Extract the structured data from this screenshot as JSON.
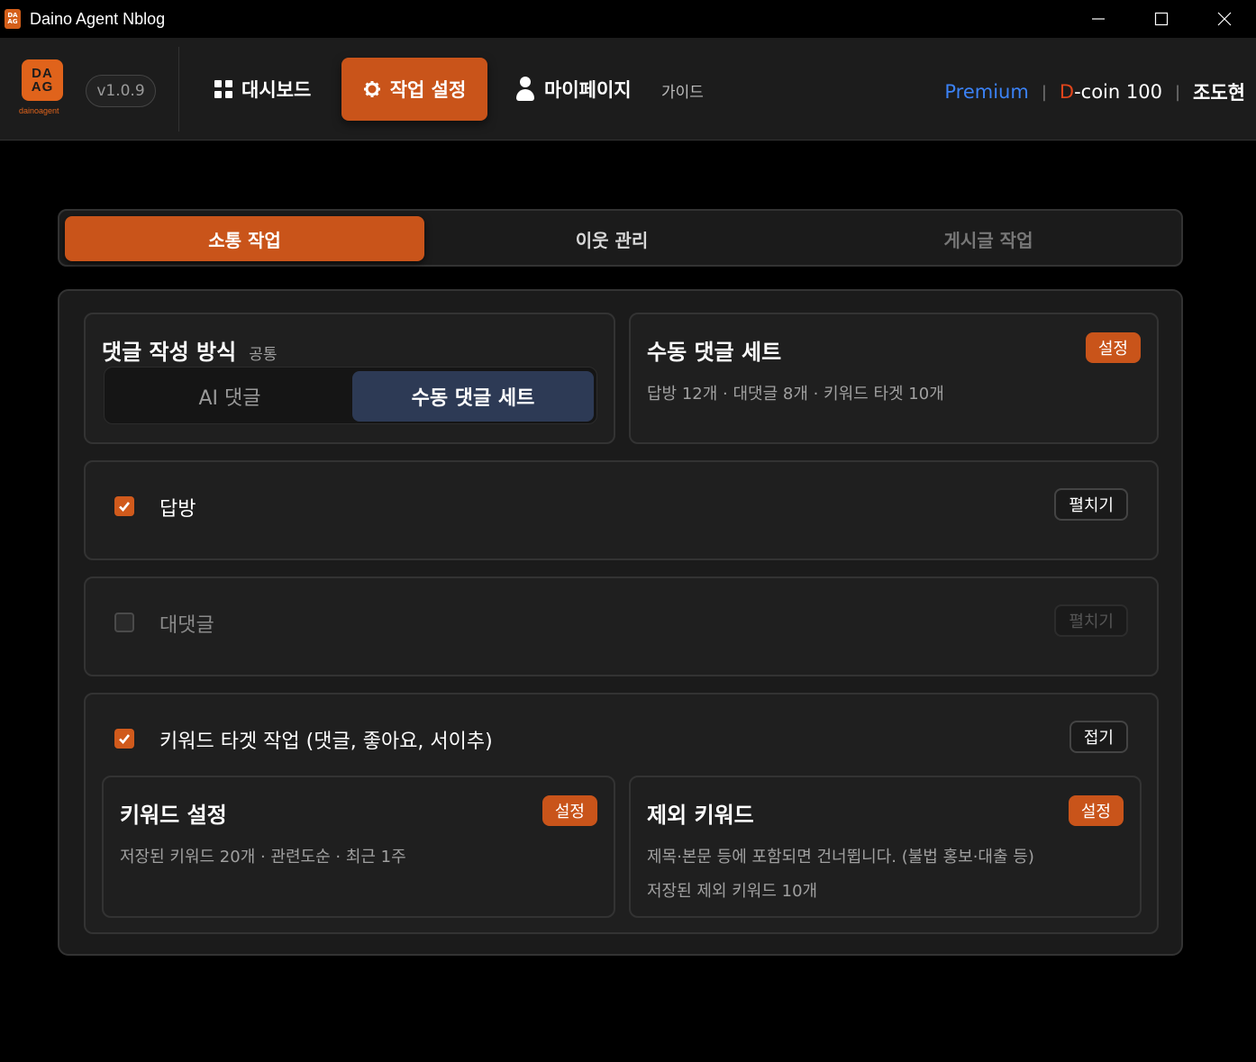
{
  "window": {
    "title": "Daino Agent Nblog",
    "logo_text": "DA AG",
    "minimize": "—",
    "maximize": "☐",
    "close": "✕"
  },
  "header": {
    "logo_line1": "DA",
    "logo_line2": "AG",
    "logo_sub": "dainoagent",
    "version": "v1.0.9",
    "nav": [
      {
        "label": "대시보드",
        "icon": "grid-icon"
      },
      {
        "label": "작업 설정",
        "icon": "gear-icon",
        "active": true
      },
      {
        "label": "마이페이지",
        "icon": "user-icon"
      }
    ],
    "guide": "가이드",
    "plan": "Premium",
    "dcoin_prefix": "D",
    "dcoin_rest": "-coin 100",
    "user": "조도현",
    "separator": "|",
    "colors": {
      "accent": "#c9541a",
      "premium": "#3b82f6",
      "dcoin": "#e0451b"
    }
  },
  "tabs": [
    "소통 작업",
    "이웃 관리",
    "게시글 작업"
  ],
  "comment_method": {
    "title": "댓글 작성 방식",
    "tag": "공통",
    "options": [
      "AI 댓글",
      "수동 댓글 세트"
    ],
    "selected": "수동 댓글 세트"
  },
  "manual_set": {
    "title": "수동 댓글 세트",
    "button": "설정",
    "summary": "답방 12개 · 대댓글 8개 · 키워드 타겟 10개"
  },
  "sections": {
    "reply_visit": {
      "label": "답방",
      "checked": true,
      "button": "펼치기"
    },
    "sub_comment": {
      "label": "대댓글",
      "checked": false,
      "button": "펼치기"
    },
    "keyword_target": {
      "label": "키워드 타겟 작업 (댓글, 좋아요, 서이추)",
      "checked": true,
      "button": "접기"
    }
  },
  "keyword_settings": {
    "title": "키워드 설정",
    "button": "설정",
    "summary": "저장된 키워드 20개 · 관련도순 · 최근 1주"
  },
  "exclude_keywords": {
    "title": "제외 키워드",
    "button": "설정",
    "desc": "제목·본문 등에 포함되면 건너뜁니다. (불법 홍보·대출 등)",
    "summary": "저장된 제외 키워드 10개"
  }
}
